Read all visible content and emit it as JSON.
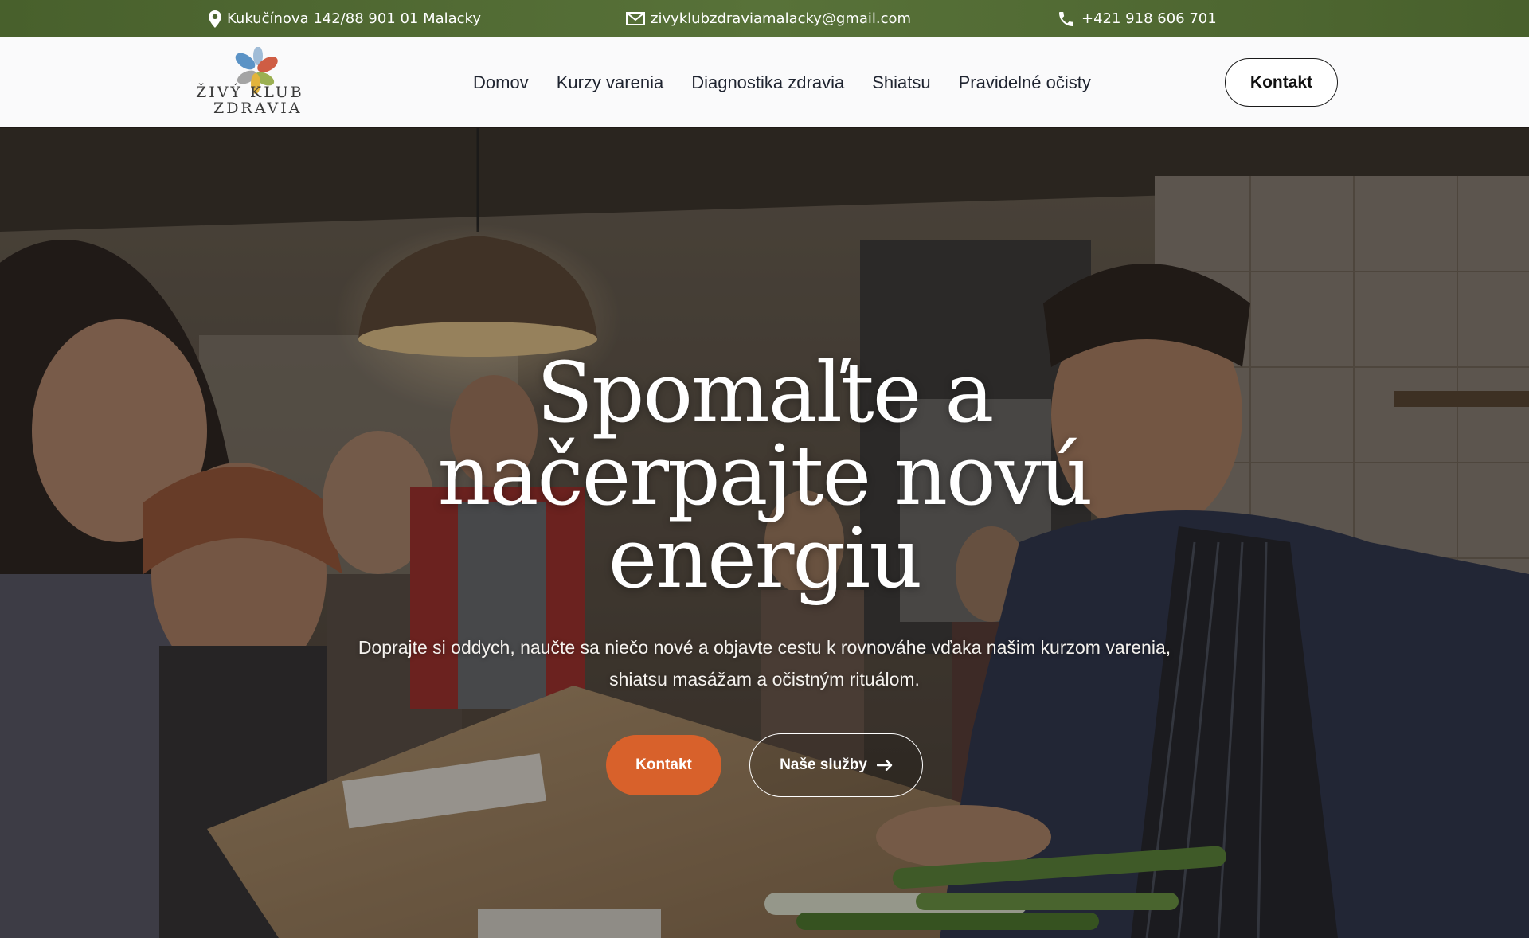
{
  "topbar": {
    "address": "Kukučínova 142/88 901 01 Malacky",
    "email": "zivyklubzdraviamalacky@gmail.com",
    "phone": "+421 918 606 701",
    "address_icon": "map-pin-icon",
    "email_icon": "envelope-icon",
    "phone_icon": "phone-icon",
    "background": "#587239"
  },
  "header": {
    "logo": {
      "line1": "ŽIVÝ KLUB",
      "line2": "ZDRAVIA",
      "petal_colors": [
        "#5b93c6",
        "#cf5d44",
        "#e3b43c",
        "#9bb052",
        "#9a9a9a"
      ]
    },
    "nav": [
      {
        "label": "Domov"
      },
      {
        "label": "Kurzy varenia"
      },
      {
        "label": "Diagnostika zdravia"
      },
      {
        "label": "Shiatsu"
      },
      {
        "label": "Pravidelné očisty"
      }
    ],
    "cta_label": "Kontakt"
  },
  "hero": {
    "title": "Spomaľte a načerpajte novú energiu",
    "subtitle": "Doprajte si oddych, naučte sa niečo nové a objavte cestu k rovnováhe vďaka našim kurzom varenia, shiatsu masážam a očistným rituálom.",
    "primary_button": "Kontakt",
    "secondary_button": "Naše služby",
    "secondary_icon": "arrow-right-icon",
    "primary_color": "#d8612b"
  }
}
